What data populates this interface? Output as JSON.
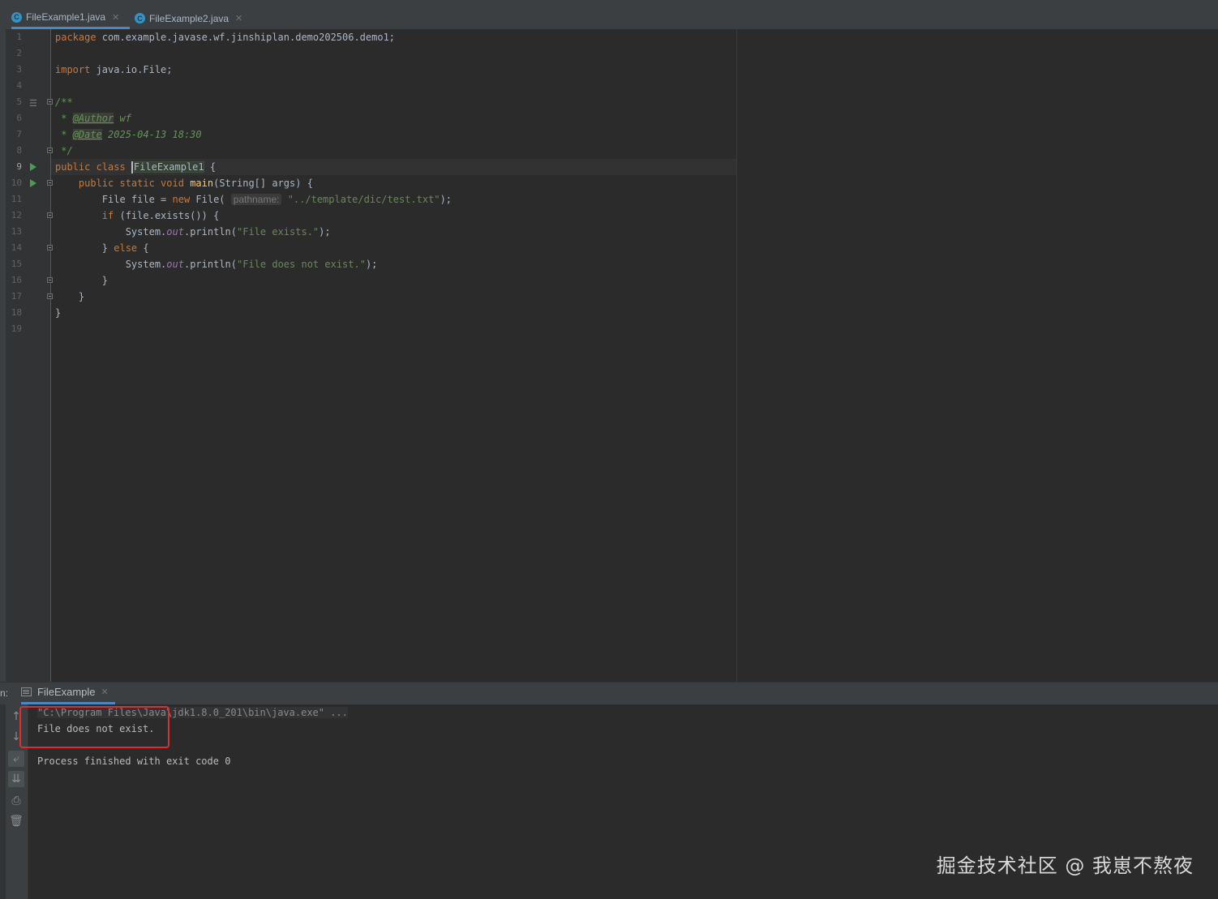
{
  "tabs": [
    {
      "label": "FileExample1.java",
      "active": true
    },
    {
      "label": "FileExample2.java",
      "active": false
    }
  ],
  "line_numbers": [
    "1",
    "2",
    "3",
    "4",
    "5",
    "6",
    "7",
    "8",
    "9",
    "10",
    "11",
    "12",
    "13",
    "14",
    "15",
    "16",
    "17",
    "18",
    "19"
  ],
  "code": {
    "l1_kw": "package",
    "l1_rest": " com.example.javase.wf.jinshiplan.demo202506.demo1;",
    "l3_kw": "import",
    "l3_rest": " java.io.File;",
    "l5": "/**",
    "l6_star": " * ",
    "l6_tag": "@Author",
    "l6_val": " wf",
    "l7_star": " * ",
    "l7_tag": "@Date",
    "l7_val": " 2025-04-13 18:30",
    "l8": " */",
    "l9_kw": "public class ",
    "l9_name": "FileExample1",
    "l9_rest": " {",
    "l10_indent": "    ",
    "l10_kw": "public static void ",
    "l10_fn": "main",
    "l10_rest": "(String[] args) {",
    "l11_a": "        File file = ",
    "l11_kw": "new",
    "l11_b": " File( ",
    "l11_hint": "pathname:",
    "l11_str": " \"../template/dic/test.txt\"",
    "l11_c": ");",
    "l12_indent": "        ",
    "l12_kw": "if",
    "l12_rest": " (file.exists()) {",
    "l13_a": "            System.",
    "l13_fld": "out",
    "l13_b": ".println(",
    "l13_str": "\"File exists.\"",
    "l13_c": ");",
    "l14_a": "        } ",
    "l14_kw": "else",
    "l14_b": " {",
    "l15_a": "            System.",
    "l15_fld": "out",
    "l15_b": ".println(",
    "l15_str": "\"File does not exist.\"",
    "l15_c": ");",
    "l16": "        }",
    "l17": "    }",
    "l18": "}"
  },
  "run": {
    "panel_label": "n:",
    "tab_label": "FileExample",
    "command": "\"C:\\Program Files\\Java\\jdk1.8.0_201\\bin\\java.exe\" ...",
    "output": "File does not exist.",
    "exit": "Process finished with exit code 0",
    "buttons": [
      "up-arrow-icon",
      "down-arrow-icon",
      "soft-wrap-icon",
      "scroll-to-end-icon",
      "print-icon",
      "trash-icon"
    ]
  },
  "watermark": "掘金技术社区 @ 我崽不熬夜",
  "colors": {
    "keyword": "#cc7832",
    "string": "#6a8759",
    "function": "#ffc66d",
    "field": "#9876aa",
    "doc": "#629755",
    "accent": "#4a88c7",
    "highlight_box": "#e52c2c"
  }
}
